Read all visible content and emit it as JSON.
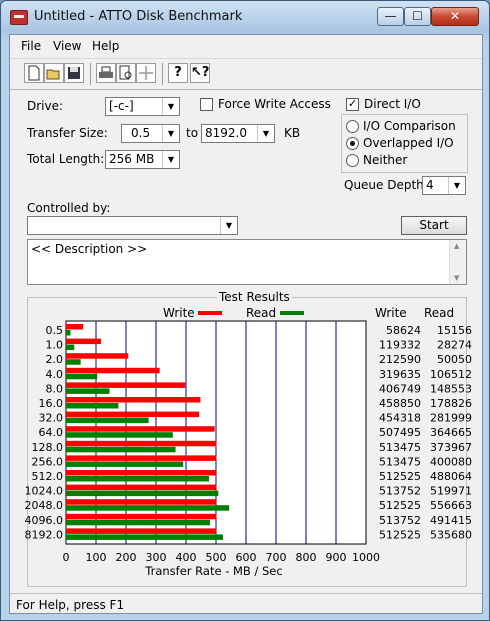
{
  "window": {
    "title": "Untitled - ATTO Disk Benchmark",
    "controls": {
      "minimize": "—",
      "maximize": "☐",
      "close": "✕"
    }
  },
  "menu": [
    "File",
    "View",
    "Help"
  ],
  "toolbar": [
    "new-icon",
    "open-icon",
    "save-icon",
    "print-icon",
    "print-preview-icon",
    "move-icon",
    "help-icon",
    "context-help-icon"
  ],
  "settings": {
    "drive_label": "Drive:",
    "drive_value": "[-c-]",
    "force_write_label": "Force Write Access",
    "force_write_checked": false,
    "direct_io_label": "Direct I/O",
    "direct_io_checked": true,
    "transfer_size_label": "Transfer Size:",
    "transfer_from": "0.5",
    "to_label": "to",
    "transfer_to": "8192.0",
    "kb_label": "KB",
    "total_length_label": "Total Length:",
    "total_length_value": "256 MB",
    "io_options": [
      {
        "label": "I/O Comparison",
        "selected": false
      },
      {
        "label": "Overlapped I/O",
        "selected": true
      },
      {
        "label": "Neither",
        "selected": false
      }
    ],
    "queue_depth_label": "Queue Depth:",
    "queue_depth_value": "4",
    "controlled_by_label": "Controlled by:",
    "controlled_by_value": "",
    "start_label": "Start",
    "description": "<< Description >>"
  },
  "results": {
    "group_label": "Test Results",
    "write_legend": "Write",
    "read_legend": "Read",
    "write_col": "Write",
    "read_col": "Read",
    "write_color": "#ff0000",
    "read_color": "#008000"
  },
  "chart_data": {
    "type": "bar",
    "orientation": "horizontal",
    "xlabel": "Transfer Rate - MB / Sec",
    "xlim": [
      0,
      1000
    ],
    "xticks": [
      0,
      100,
      200,
      300,
      400,
      500,
      600,
      700,
      800,
      900,
      1000
    ],
    "grid": true,
    "categories": [
      "0.5",
      "1.0",
      "2.0",
      "4.0",
      "8.0",
      "16.0",
      "32.0",
      "64.0",
      "128.0",
      "256.0",
      "512.0",
      "1024.0",
      "2048.0",
      "4096.0",
      "8192.0"
    ],
    "series": [
      {
        "name": "Write",
        "values": [
          58624,
          119332,
          212590,
          319635,
          406749,
          458850,
          454318,
          507495,
          513475,
          513475,
          512525,
          513752,
          512525,
          513752,
          512525
        ]
      },
      {
        "name": "Read",
        "values": [
          15156,
          28274,
          50050,
          106512,
          148553,
          178826,
          281999,
          364665,
          373967,
          400080,
          488064,
          519971,
          556663,
          491415,
          535680
        ]
      }
    ]
  },
  "status": "For Help, press F1"
}
